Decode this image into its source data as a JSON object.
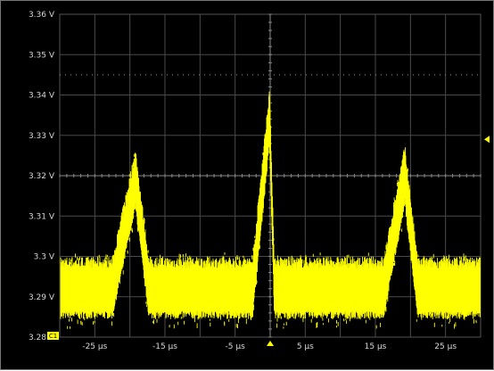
{
  "chart_data": {
    "type": "line",
    "title": "",
    "xlabel": "",
    "ylabel": "",
    "xlim": [
      -30,
      30
    ],
    "ylim": [
      3.28,
      3.36
    ],
    "grid": true,
    "y_ticks": [
      {
        "value": 3.36,
        "label": "3.36 V"
      },
      {
        "value": 3.35,
        "label": "3.35 V"
      },
      {
        "value": 3.34,
        "label": "3.34 V"
      },
      {
        "value": 3.33,
        "label": "3.33 V"
      },
      {
        "value": 3.32,
        "label": "3.32 V"
      },
      {
        "value": 3.31,
        "label": "3.31 V"
      },
      {
        "value": 3.3,
        "label": "3.3 V"
      },
      {
        "value": 3.29,
        "label": "3.29 V"
      },
      {
        "value": 3.28,
        "label": "3.28 V"
      }
    ],
    "x_ticks": [
      {
        "value": -25,
        "label": "-25 µs"
      },
      {
        "value": -15,
        "label": "-15 µs"
      },
      {
        "value": -5,
        "label": "-5 µs"
      },
      {
        "value": 5,
        "label": "5 µs"
      },
      {
        "value": 15,
        "label": "15 µs"
      },
      {
        "value": 25,
        "label": "25 µs"
      }
    ],
    "channel_label": "C1",
    "trace_color": "#ffff00",
    "baseline_v": 3.2915,
    "noise_band_v": [
      3.2855,
      3.2975
    ],
    "spikes": [
      {
        "peak_time": -19.2,
        "peak_v": 3.3185,
        "start_time": -22.5,
        "end_time": -17.3
      },
      {
        "peak_time": -0.1,
        "peak_v": 3.334,
        "start_time": -2.5,
        "end_time": 0.6
      },
      {
        "peak_time": 19.2,
        "peak_v": 3.3195,
        "start_time": 16.2,
        "end_time": 21.0
      }
    ],
    "trigger_time": 0,
    "trigger_level_v": 3.329,
    "reference_level_v": 3.345
  }
}
